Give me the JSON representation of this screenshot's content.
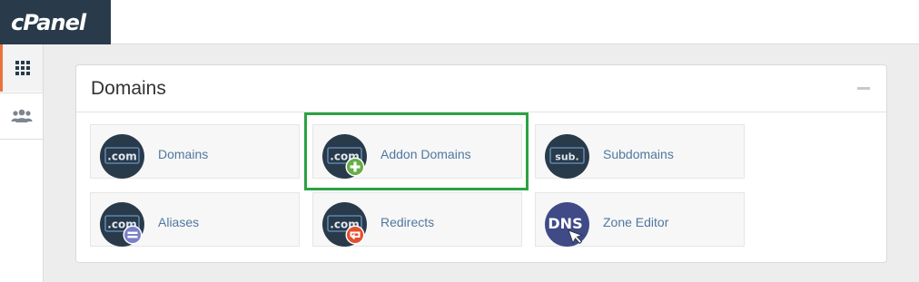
{
  "app": {
    "logo_text": "cPanel"
  },
  "sidebar": {
    "items": [
      {
        "name": "tools",
        "icon": "grid-icon",
        "active": true
      },
      {
        "name": "users",
        "icon": "users-icon",
        "active": false
      }
    ]
  },
  "panel": {
    "title": "Domains",
    "tiles": [
      {
        "label": "Domains",
        "icon": "dotcom-icon"
      },
      {
        "label": "Addon Domains",
        "icon": "addon-domains-icon",
        "highlighted": true
      },
      {
        "label": "Subdomains",
        "icon": "subdomains-icon"
      },
      {
        "label": "Aliases",
        "icon": "aliases-icon"
      },
      {
        "label": "Redirects",
        "icon": "redirects-icon"
      },
      {
        "label": "Zone Editor",
        "icon": "dns-zone-icon"
      }
    ],
    "icon_texts": {
      "com": ".com",
      "sub": "sub.",
      "dns": "DNS"
    }
  },
  "colors": {
    "brand_dark": "#293a4a",
    "accent_orange": "#e8733a",
    "link_blue": "#4f77a0",
    "highlight_green": "#2ca243",
    "badge_green": "#66ad45",
    "badge_purple": "#7b81c7",
    "badge_red": "#e4502e"
  }
}
